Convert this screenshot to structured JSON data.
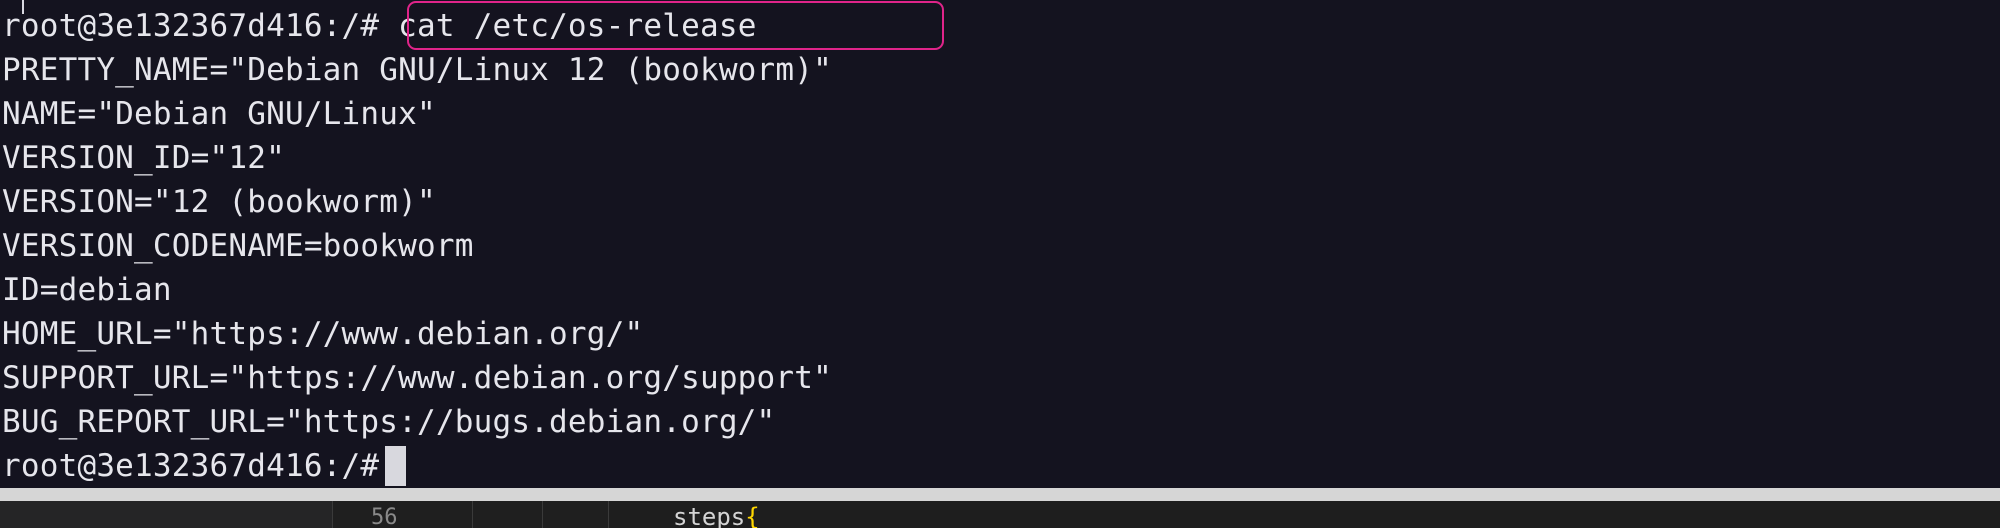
{
  "terminal": {
    "prompt": "root@3e132367d416:/#",
    "command": "cat /etc/os-release",
    "output": [
      "PRETTY_NAME=\"Debian GNU/Linux 12 (bookworm)\"",
      "NAME=\"Debian GNU/Linux\"",
      "VERSION_ID=\"12\"",
      "VERSION=\"12 (bookworm)\"",
      "VERSION_CODENAME=bookworm",
      "ID=debian",
      "HOME_URL=\"https://www.debian.org/\"",
      "SUPPORT_URL=\"https://www.debian.org/support\"",
      "BUG_REPORT_URL=\"https://bugs.debian.org/\""
    ],
    "final_prompt": "root@3e132367d416:/#",
    "highlight_color": "#e0248a"
  },
  "editor": {
    "line_number": "56",
    "code_fragment": "steps",
    "code_brace": "{"
  }
}
